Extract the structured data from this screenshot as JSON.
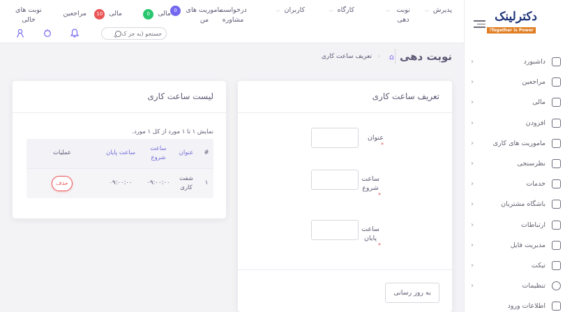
{
  "brand": {
    "name": "دکترلینک",
    "tagline": "Together is Power!"
  },
  "colors": {
    "accent": "#7367f0",
    "danger": "#ea5455",
    "success": "#28c76f",
    "brand_orange": "#e07b1f",
    "brand_blue": "#20367a"
  },
  "sidebar": {
    "items": [
      {
        "label": "داشبورد",
        "icon": "dashboard-icon"
      },
      {
        "label": "مراجعین",
        "icon": "chart-line-icon"
      },
      {
        "label": "مالی",
        "icon": "finance-icon"
      },
      {
        "label": "افزودن",
        "icon": "plus-square-icon"
      },
      {
        "label": "ماموریت های کاری",
        "icon": "layers-icon"
      },
      {
        "label": "نظرسنجی",
        "icon": "layers-icon"
      },
      {
        "label": "خدمات",
        "icon": "layers-icon"
      },
      {
        "label": "باشگاه مشتریان",
        "icon": "network-icon"
      },
      {
        "label": "ارتباطات",
        "icon": "phone-icon"
      },
      {
        "label": "مدیریت فایل",
        "icon": "file-icon"
      },
      {
        "label": "تیکت",
        "icon": "badge-check-icon"
      },
      {
        "label": "تنظیمات",
        "icon": "gear-icon"
      },
      {
        "label": "اطلاعات ورود",
        "icon": "login-icon"
      }
    ]
  },
  "topnav": {
    "reception": "پذیرش",
    "appointment": "نوبت دهی",
    "workshop": "کارگاه",
    "users": "کاربران",
    "consult_request": "درخواست مشاوره",
    "my_missions": "ماموریت های من",
    "my_missions_badge": "0",
    "finance": "مالی",
    "finance_badge": "10",
    "clients": "مراجعین",
    "free_slots": "نوبت های خالی",
    "search_placeholder": "جستجو (به جز ک"
  },
  "breadcrumb": {
    "page_title": "نوبت دهی",
    "current": "تعریف ساعت کاری"
  },
  "define_card": {
    "title": "تعریف ساعت کاری",
    "field_title": "عنوان",
    "field_start": "ساعت شروع",
    "field_end": "ساعت پایان",
    "required_mark": "*",
    "submit": "به روز رسانی"
  },
  "list_card": {
    "title": "لیست ساعت کاری",
    "info": "نمایش ۱ تا ۱ مورد از کل ۱ مورد.",
    "columns": [
      "#",
      "عنوان",
      "ساعت شروع",
      "ساعت پایان",
      "عملیات"
    ],
    "rows": [
      {
        "index": "۱",
        "title": "شفت کاری",
        "start": "۰۹:۰۰:۰۰",
        "end": "۰۹:۰۰:۰۰",
        "action": "حذف"
      }
    ]
  }
}
